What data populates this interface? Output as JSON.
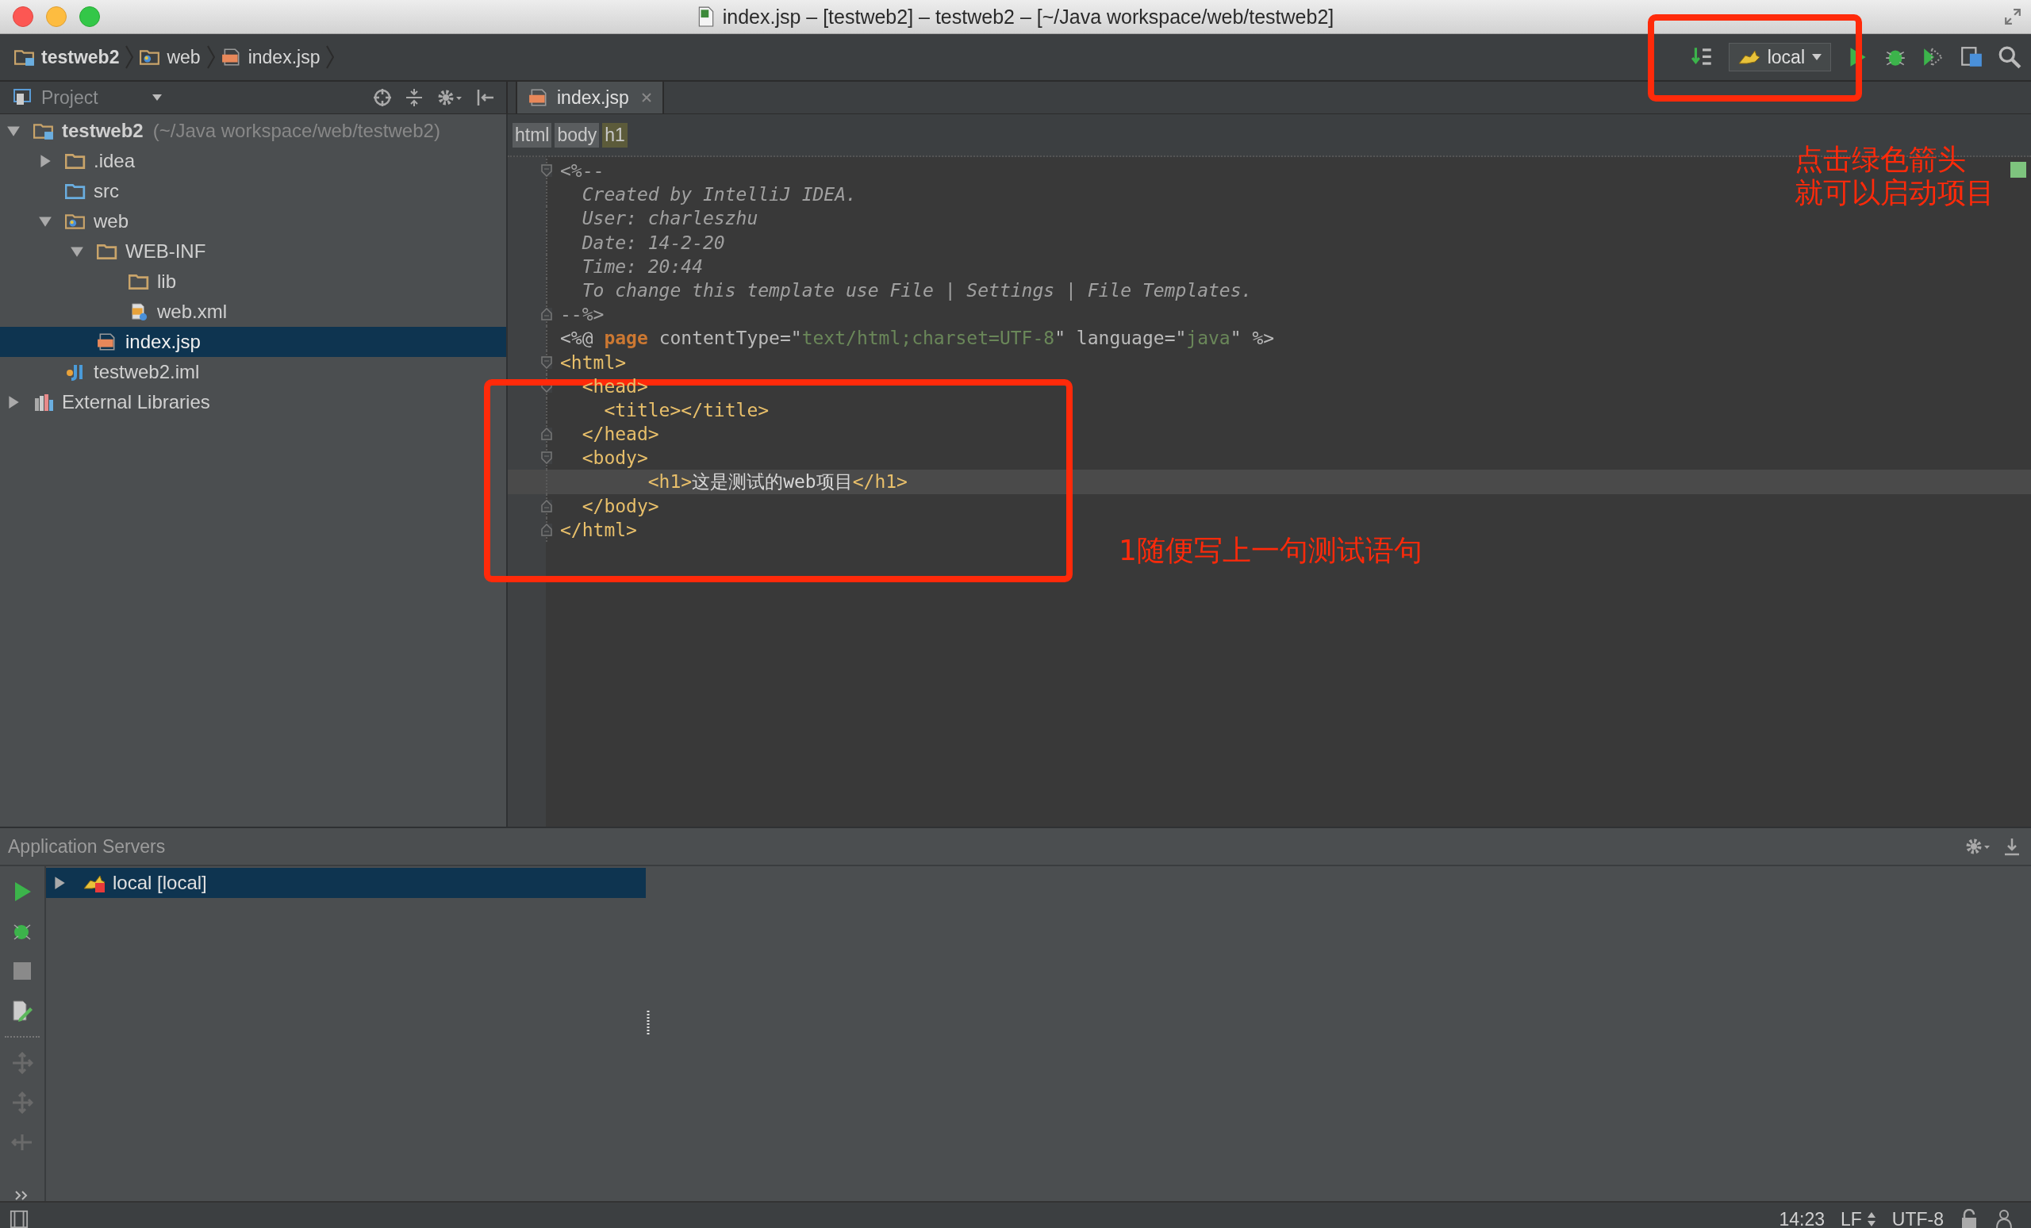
{
  "window": {
    "title": "index.jsp – [testweb2] – testweb2 – [~/Java workspace/web/testweb2]"
  },
  "breadcrumbs": [
    {
      "label": "testweb2",
      "kind": "module"
    },
    {
      "label": "web",
      "kind": "web-folder"
    },
    {
      "label": "index.jsp",
      "kind": "jsp"
    }
  ],
  "toolbar": {
    "run_config": "local"
  },
  "project_panel": {
    "title": "Project",
    "tree": [
      {
        "label": "testweb2",
        "path": "(~/Java workspace/web/testweb2)",
        "kind": "module",
        "expanded": true,
        "selected": false,
        "children": [
          {
            "label": ".idea",
            "kind": "folder",
            "expanded": false,
            "selected": false
          },
          {
            "label": "src",
            "kind": "source-folder",
            "selected": false
          },
          {
            "label": "web",
            "kind": "web-folder",
            "expanded": true,
            "selected": false,
            "children": [
              {
                "label": "WEB-INF",
                "kind": "folder",
                "expanded": true,
                "selected": false,
                "children": [
                  {
                    "label": "lib",
                    "kind": "folder",
                    "selected": false
                  },
                  {
                    "label": "web.xml",
                    "kind": "xml",
                    "selected": false
                  }
                ]
              },
              {
                "label": "index.jsp",
                "kind": "jsp",
                "selected": true
              }
            ]
          },
          {
            "label": "testweb2.iml",
            "kind": "iml",
            "selected": false
          }
        ]
      },
      {
        "label": "External Libraries",
        "kind": "libraries",
        "expanded": false,
        "selected": false
      }
    ]
  },
  "editor": {
    "tabs": [
      {
        "label": "index.jsp",
        "selected": true
      }
    ],
    "tag_path": [
      {
        "label": "html",
        "selected": false
      },
      {
        "label": "body",
        "selected": false
      },
      {
        "label": "h1",
        "selected": true
      }
    ],
    "lines": [
      {
        "fold_open": true,
        "fold_close": false,
        "current": false,
        "tokens": [
          {
            "kind": "comment-mark",
            "text": "<%--"
          }
        ]
      },
      {
        "fold_open": false,
        "fold_close": false,
        "current": false,
        "tokens": [
          {
            "kind": "comment",
            "text": "  Created by IntelliJ IDEA."
          }
        ]
      },
      {
        "fold_open": false,
        "fold_close": false,
        "current": false,
        "tokens": [
          {
            "kind": "comment",
            "text": "  User: charleszhu"
          }
        ]
      },
      {
        "fold_open": false,
        "fold_close": false,
        "current": false,
        "tokens": [
          {
            "kind": "comment",
            "text": "  Date: 14-2-20"
          }
        ]
      },
      {
        "fold_open": false,
        "fold_close": false,
        "current": false,
        "tokens": [
          {
            "kind": "comment",
            "text": "  Time: 20:44"
          }
        ]
      },
      {
        "fold_open": false,
        "fold_close": false,
        "current": false,
        "tokens": [
          {
            "kind": "comment",
            "text": "  To change this template use File | Settings | File Templates."
          }
        ]
      },
      {
        "fold_open": false,
        "fold_close": true,
        "current": false,
        "tokens": [
          {
            "kind": "comment-mark",
            "text": "--%>"
          }
        ]
      },
      {
        "fold_open": false,
        "fold_close": false,
        "current": false,
        "tokens": [
          {
            "kind": "directive",
            "text": "<%@ "
          },
          {
            "kind": "keyword",
            "text": "page"
          },
          {
            "kind": "attr",
            "text": " contentType=\""
          },
          {
            "kind": "string",
            "text": "text/html;charset=UTF-8"
          },
          {
            "kind": "attr",
            "text": "\" language=\""
          },
          {
            "kind": "string",
            "text": "java"
          },
          {
            "kind": "attr",
            "text": "\" %>"
          }
        ]
      },
      {
        "fold_open": true,
        "fold_close": false,
        "current": false,
        "tokens": [
          {
            "kind": "tag",
            "text": "<html>"
          }
        ]
      },
      {
        "fold_open": true,
        "fold_close": false,
        "current": false,
        "tokens": [
          {
            "kind": "tag",
            "text": "  <head>"
          }
        ]
      },
      {
        "fold_open": false,
        "fold_close": false,
        "current": false,
        "tokens": [
          {
            "kind": "tag",
            "text": "    <title></title>"
          }
        ]
      },
      {
        "fold_open": false,
        "fold_close": true,
        "current": false,
        "tokens": [
          {
            "kind": "tag",
            "text": "  </head>"
          }
        ]
      },
      {
        "fold_open": true,
        "fold_close": false,
        "current": false,
        "tokens": [
          {
            "kind": "tag",
            "text": "  <body>"
          }
        ]
      },
      {
        "fold_open": false,
        "fold_close": false,
        "current": true,
        "tokens": [
          {
            "kind": "tag",
            "text": "        <h1>"
          },
          {
            "kind": "text",
            "text": "这是测试的web项目"
          },
          {
            "kind": "tag",
            "text": "</h1>"
          }
        ]
      },
      {
        "fold_open": false,
        "fold_close": true,
        "current": false,
        "tokens": [
          {
            "kind": "tag",
            "text": "  </body>"
          }
        ]
      },
      {
        "fold_open": false,
        "fold_close": true,
        "current": false,
        "tokens": [
          {
            "kind": "tag",
            "text": "</html>"
          }
        ]
      }
    ]
  },
  "annotations": {
    "run_hint": [
      "点击绿色箭头",
      "就可以启动项目"
    ],
    "code_hint": "1随便写上一句测试语句"
  },
  "servers_panel": {
    "title": "Application Servers",
    "servers": [
      {
        "label": "local [local]",
        "expanded": false,
        "selected": true
      }
    ]
  },
  "status_bar": {
    "position": "14:23",
    "line_separator": "LF",
    "encoding": "UTF-8"
  }
}
